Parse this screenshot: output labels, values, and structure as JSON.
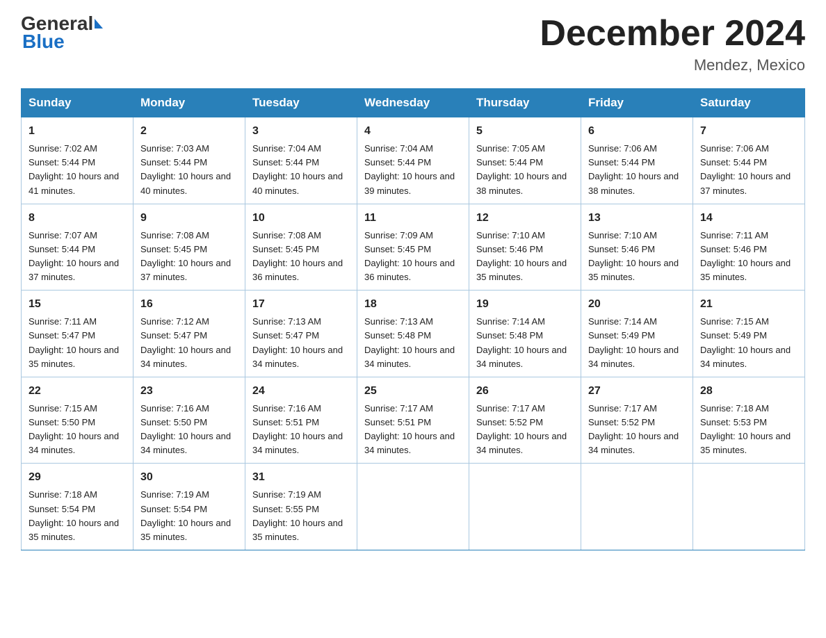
{
  "header": {
    "logo": {
      "general": "General",
      "blue": "Blue"
    },
    "title": "December 2024",
    "location": "Mendez, Mexico"
  },
  "calendar": {
    "days_of_week": [
      "Sunday",
      "Monday",
      "Tuesday",
      "Wednesday",
      "Thursday",
      "Friday",
      "Saturday"
    ],
    "weeks": [
      [
        {
          "day": "1",
          "sunrise": "7:02 AM",
          "sunset": "5:44 PM",
          "daylight": "10 hours and 41 minutes."
        },
        {
          "day": "2",
          "sunrise": "7:03 AM",
          "sunset": "5:44 PM",
          "daylight": "10 hours and 40 minutes."
        },
        {
          "day": "3",
          "sunrise": "7:04 AM",
          "sunset": "5:44 PM",
          "daylight": "10 hours and 40 minutes."
        },
        {
          "day": "4",
          "sunrise": "7:04 AM",
          "sunset": "5:44 PM",
          "daylight": "10 hours and 39 minutes."
        },
        {
          "day": "5",
          "sunrise": "7:05 AM",
          "sunset": "5:44 PM",
          "daylight": "10 hours and 38 minutes."
        },
        {
          "day": "6",
          "sunrise": "7:06 AM",
          "sunset": "5:44 PM",
          "daylight": "10 hours and 38 minutes."
        },
        {
          "day": "7",
          "sunrise": "7:06 AM",
          "sunset": "5:44 PM",
          "daylight": "10 hours and 37 minutes."
        }
      ],
      [
        {
          "day": "8",
          "sunrise": "7:07 AM",
          "sunset": "5:44 PM",
          "daylight": "10 hours and 37 minutes."
        },
        {
          "day": "9",
          "sunrise": "7:08 AM",
          "sunset": "5:45 PM",
          "daylight": "10 hours and 37 minutes."
        },
        {
          "day": "10",
          "sunrise": "7:08 AM",
          "sunset": "5:45 PM",
          "daylight": "10 hours and 36 minutes."
        },
        {
          "day": "11",
          "sunrise": "7:09 AM",
          "sunset": "5:45 PM",
          "daylight": "10 hours and 36 minutes."
        },
        {
          "day": "12",
          "sunrise": "7:10 AM",
          "sunset": "5:46 PM",
          "daylight": "10 hours and 35 minutes."
        },
        {
          "day": "13",
          "sunrise": "7:10 AM",
          "sunset": "5:46 PM",
          "daylight": "10 hours and 35 minutes."
        },
        {
          "day": "14",
          "sunrise": "7:11 AM",
          "sunset": "5:46 PM",
          "daylight": "10 hours and 35 minutes."
        }
      ],
      [
        {
          "day": "15",
          "sunrise": "7:11 AM",
          "sunset": "5:47 PM",
          "daylight": "10 hours and 35 minutes."
        },
        {
          "day": "16",
          "sunrise": "7:12 AM",
          "sunset": "5:47 PM",
          "daylight": "10 hours and 34 minutes."
        },
        {
          "day": "17",
          "sunrise": "7:13 AM",
          "sunset": "5:47 PM",
          "daylight": "10 hours and 34 minutes."
        },
        {
          "day": "18",
          "sunrise": "7:13 AM",
          "sunset": "5:48 PM",
          "daylight": "10 hours and 34 minutes."
        },
        {
          "day": "19",
          "sunrise": "7:14 AM",
          "sunset": "5:48 PM",
          "daylight": "10 hours and 34 minutes."
        },
        {
          "day": "20",
          "sunrise": "7:14 AM",
          "sunset": "5:49 PM",
          "daylight": "10 hours and 34 minutes."
        },
        {
          "day": "21",
          "sunrise": "7:15 AM",
          "sunset": "5:49 PM",
          "daylight": "10 hours and 34 minutes."
        }
      ],
      [
        {
          "day": "22",
          "sunrise": "7:15 AM",
          "sunset": "5:50 PM",
          "daylight": "10 hours and 34 minutes."
        },
        {
          "day": "23",
          "sunrise": "7:16 AM",
          "sunset": "5:50 PM",
          "daylight": "10 hours and 34 minutes."
        },
        {
          "day": "24",
          "sunrise": "7:16 AM",
          "sunset": "5:51 PM",
          "daylight": "10 hours and 34 minutes."
        },
        {
          "day": "25",
          "sunrise": "7:17 AM",
          "sunset": "5:51 PM",
          "daylight": "10 hours and 34 minutes."
        },
        {
          "day": "26",
          "sunrise": "7:17 AM",
          "sunset": "5:52 PM",
          "daylight": "10 hours and 34 minutes."
        },
        {
          "day": "27",
          "sunrise": "7:17 AM",
          "sunset": "5:52 PM",
          "daylight": "10 hours and 34 minutes."
        },
        {
          "day": "28",
          "sunrise": "7:18 AM",
          "sunset": "5:53 PM",
          "daylight": "10 hours and 35 minutes."
        }
      ],
      [
        {
          "day": "29",
          "sunrise": "7:18 AM",
          "sunset": "5:54 PM",
          "daylight": "10 hours and 35 minutes."
        },
        {
          "day": "30",
          "sunrise": "7:19 AM",
          "sunset": "5:54 PM",
          "daylight": "10 hours and 35 minutes."
        },
        {
          "day": "31",
          "sunrise": "7:19 AM",
          "sunset": "5:55 PM",
          "daylight": "10 hours and 35 minutes."
        },
        null,
        null,
        null,
        null
      ]
    ]
  }
}
